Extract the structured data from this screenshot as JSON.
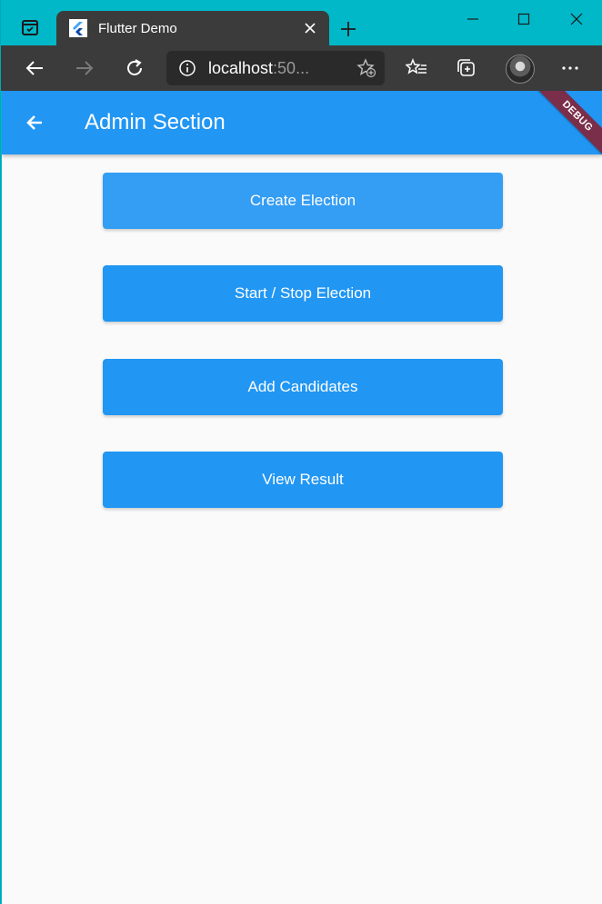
{
  "browser": {
    "tab_title": "Flutter Demo",
    "address_host": "localhost",
    "address_rest": ":50...",
    "icons": {
      "tab_actions": "tab-actions-icon",
      "favicon": "flutter-logo-icon",
      "close": "close-icon",
      "new_tab": "plus-icon",
      "back": "arrow-left-icon",
      "forward": "arrow-right-icon",
      "refresh": "refresh-icon",
      "info": "info-icon",
      "favorite_add": "star-plus-icon",
      "favorites": "favorites-list-icon",
      "collections": "collections-icon",
      "more": "ellipsis-icon"
    }
  },
  "appbar": {
    "title": "Admin Section",
    "color": "#2196f3",
    "debug_label": "DEBUG"
  },
  "buttons": [
    {
      "label": "Create Election"
    },
    {
      "label": "Start / Stop Election"
    },
    {
      "label": "Add Candidates"
    },
    {
      "label": "View Result"
    }
  ],
  "colors": {
    "accent": "#2196f3",
    "titlebar": "#00b8c8",
    "toolbar": "#3b3b3b",
    "page_bg": "#fafafa"
  }
}
